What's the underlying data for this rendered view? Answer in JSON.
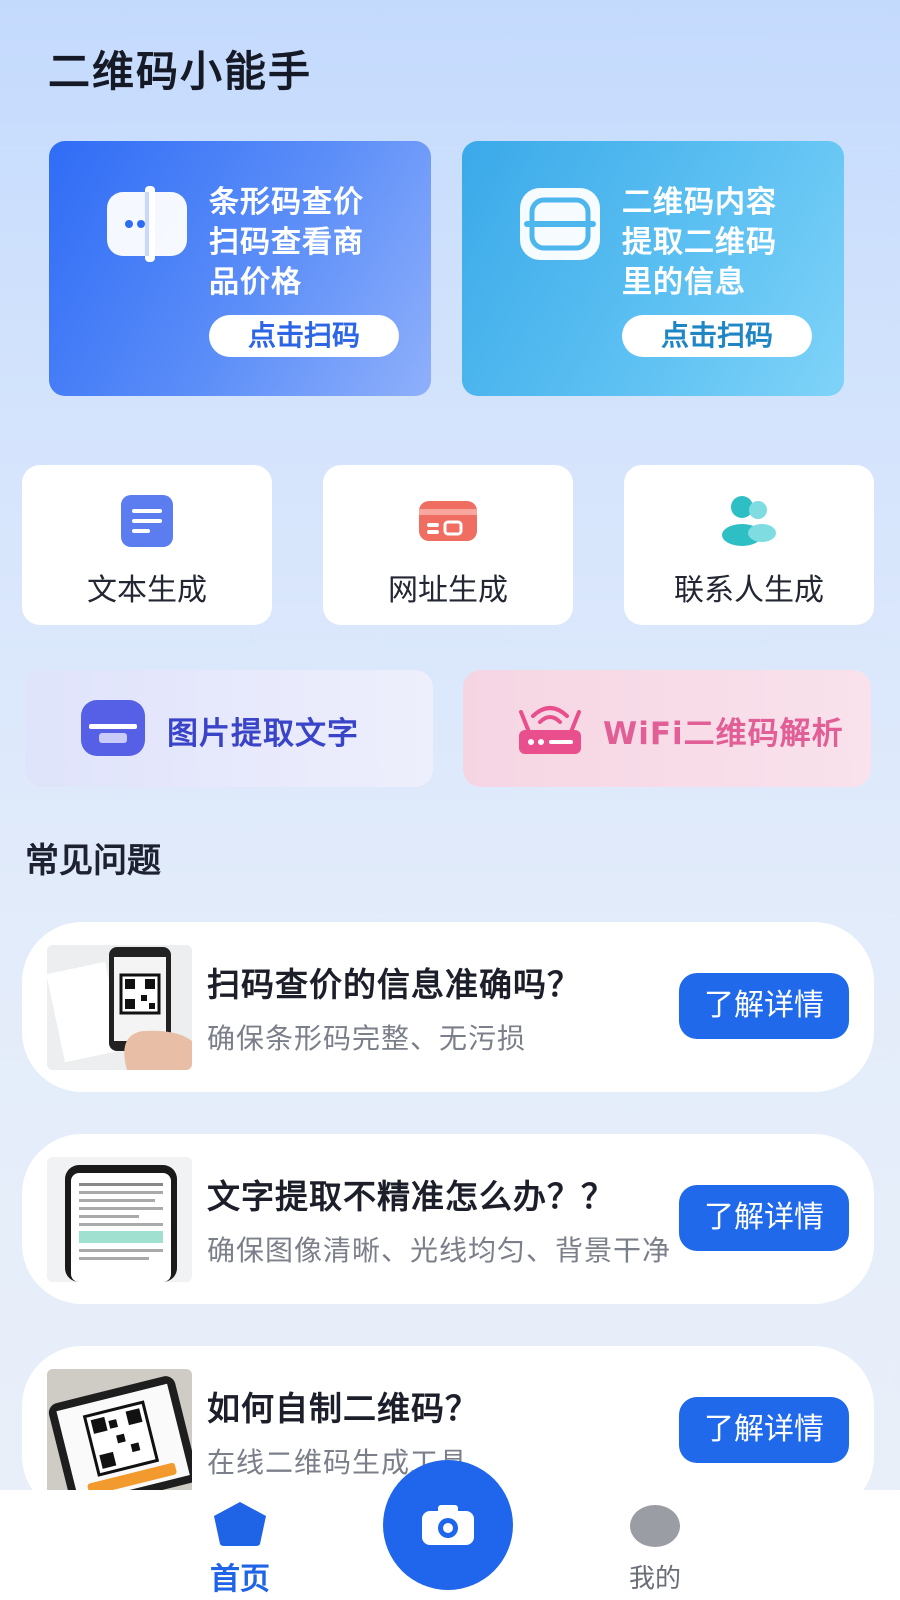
{
  "app": {
    "title": "二维码小能手"
  },
  "scan_cards": [
    {
      "line1": "条形码查价",
      "line2": "扫码查看商",
      "line3": "品价格",
      "button": "点击扫码",
      "icon": "barcode-scan-icon"
    },
    {
      "line1": "二维码内容",
      "line2": "提取二维码",
      "line3": "里的信息",
      "button": "点击扫码",
      "icon": "qr-scan-icon"
    }
  ],
  "generators": [
    {
      "label": "文本生成",
      "icon": "document-icon",
      "color": "#5b7df0"
    },
    {
      "label": "网址生成",
      "icon": "card-icon",
      "color": "#f06e61"
    },
    {
      "label": "联系人生成",
      "icon": "contacts-icon",
      "color": "#2dbfc4"
    }
  ],
  "tools": [
    {
      "label": "图片提取文字",
      "icon": "image-text-icon",
      "color": "#3a44c9"
    },
    {
      "label": "WiFi二维码解析",
      "icon": "wifi-router-icon",
      "color": "#e25e96"
    }
  ],
  "faq": {
    "heading": "常见问题",
    "items": [
      {
        "question": "扫码查价的信息准确吗？",
        "answer": "确保条形码完整、无污损",
        "button": "了解详情"
      },
      {
        "question": "文字提取不精准怎么办？？",
        "answer": "确保图像清晰、光线均匀、背景干净",
        "button": "了解详情"
      },
      {
        "question": "如何自制二维码？",
        "answer": "在线二维码生成工具",
        "button": "了解详情"
      }
    ]
  },
  "nav": {
    "home": "首页",
    "mine": "我的",
    "camera_icon": "camera-icon"
  },
  "colors": {
    "primary": "#1f66ec",
    "accent_blue": "#2f6cf6",
    "accent_cyan": "#3aa9e9"
  }
}
